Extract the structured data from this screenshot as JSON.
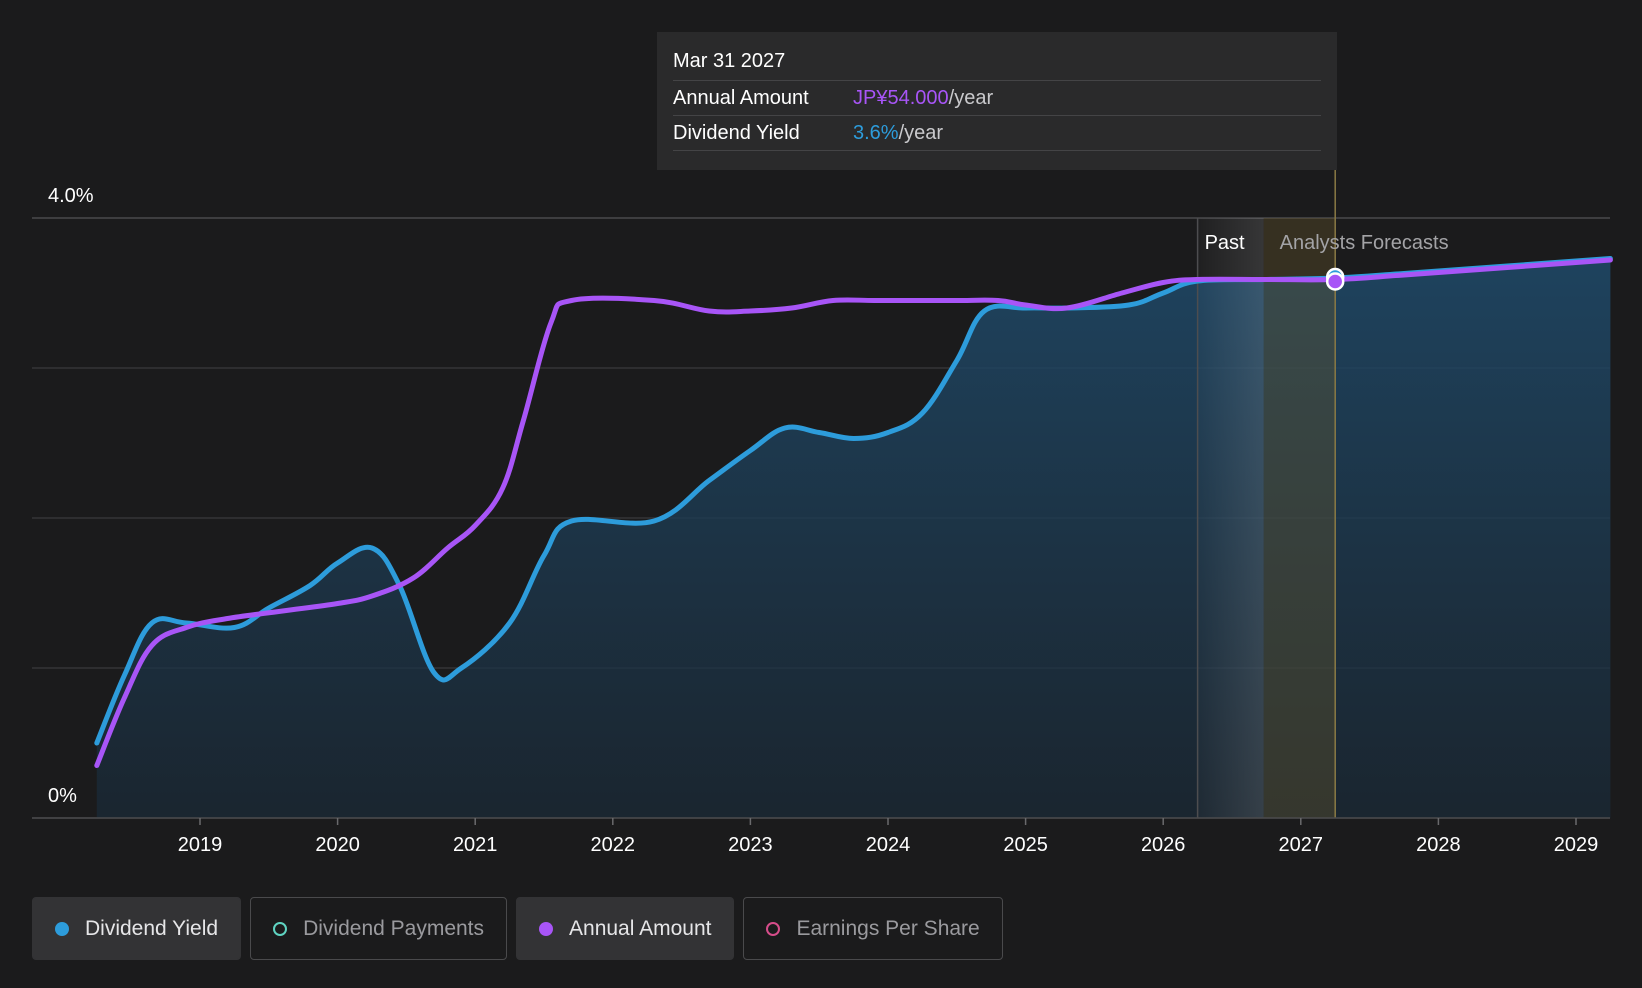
{
  "tooltip": {
    "date": "Mar 31 2027",
    "rows": [
      {
        "label": "Annual Amount",
        "value": "JP¥54.000",
        "unit": "/year",
        "color": "#a855f7"
      },
      {
        "label": "Dividend Yield",
        "value": "3.6%",
        "unit": "/year",
        "color": "#2d9cdb"
      }
    ]
  },
  "legend": [
    {
      "label": "Dividend Yield",
      "active": true,
      "color": "#2d9cdb",
      "filled": true
    },
    {
      "label": "Dividend Payments",
      "active": false,
      "color": "#5fd3c1",
      "filled": false
    },
    {
      "label": "Annual Amount",
      "active": true,
      "color": "#a855f7",
      "filled": true
    },
    {
      "label": "Earnings Per Share",
      "active": false,
      "color": "#d64d8a",
      "filled": false
    }
  ],
  "chart_data": {
    "type": "line",
    "xlabel": "",
    "ylabel": "",
    "x_ticks": [
      "2019",
      "2020",
      "2021",
      "2022",
      "2023",
      "2024",
      "2025",
      "2026",
      "2027",
      "2028",
      "2029"
    ],
    "y_ticks": [
      "0%",
      "4.0%"
    ],
    "ylim": [
      0,
      4.0
    ],
    "xlim": [
      2018.2,
      2029.25
    ],
    "grid": true,
    "regions": [
      {
        "label": "Past",
        "from": 2026.25,
        "to": 2026.73
      },
      {
        "label": "Analysts Forecasts",
        "from": 2026.73,
        "to": 2027.25
      }
    ],
    "highlight_x": 2027.25,
    "series": [
      {
        "name": "Dividend Yield",
        "color": "#2d9cdb",
        "x": [
          2018.25,
          2018.45,
          2018.65,
          2018.9,
          2019.25,
          2019.5,
          2019.8,
          2020.0,
          2020.25,
          2020.45,
          2020.7,
          2020.9,
          2021.25,
          2021.5,
          2021.7,
          2022.3,
          2022.7,
          2023.0,
          2023.25,
          2023.5,
          2023.75,
          2024.0,
          2024.25,
          2024.5,
          2024.7,
          2025.0,
          2025.3,
          2025.75,
          2026.0,
          2026.25,
          2026.75,
          2027.25,
          2027.75,
          2028.5,
          2029.25
        ],
        "y": [
          0.5,
          0.95,
          1.3,
          1.3,
          1.27,
          1.4,
          1.55,
          1.7,
          1.8,
          1.55,
          0.97,
          1.0,
          1.3,
          1.75,
          1.98,
          1.98,
          2.25,
          2.45,
          2.6,
          2.57,
          2.53,
          2.57,
          2.7,
          3.05,
          3.38,
          3.4,
          3.4,
          3.42,
          3.5,
          3.58,
          3.59,
          3.6,
          3.63,
          3.68,
          3.73
        ]
      },
      {
        "name": "Annual Amount",
        "color": "#a855f7",
        "x": [
          2018.25,
          2018.45,
          2018.65,
          2018.9,
          2019.2,
          2019.6,
          2020.0,
          2020.25,
          2020.55,
          2020.8,
          2021.0,
          2021.2,
          2021.35,
          2021.55,
          2021.7,
          2022.3,
          2022.7,
          2023.0,
          2023.3,
          2023.6,
          2023.9,
          2024.2,
          2024.5,
          2024.8,
          2025.0,
          2025.3,
          2025.7,
          2026.0,
          2026.25,
          2026.75,
          2027.25,
          2027.75,
          2028.5,
          2029.25
        ],
        "y": [
          0.35,
          0.8,
          1.15,
          1.27,
          1.33,
          1.38,
          1.43,
          1.48,
          1.6,
          1.8,
          1.95,
          2.2,
          2.65,
          3.3,
          3.45,
          3.45,
          3.38,
          3.38,
          3.4,
          3.45,
          3.45,
          3.45,
          3.45,
          3.45,
          3.42,
          3.4,
          3.5,
          3.57,
          3.59,
          3.59,
          3.59,
          3.62,
          3.67,
          3.72
        ]
      }
    ]
  }
}
